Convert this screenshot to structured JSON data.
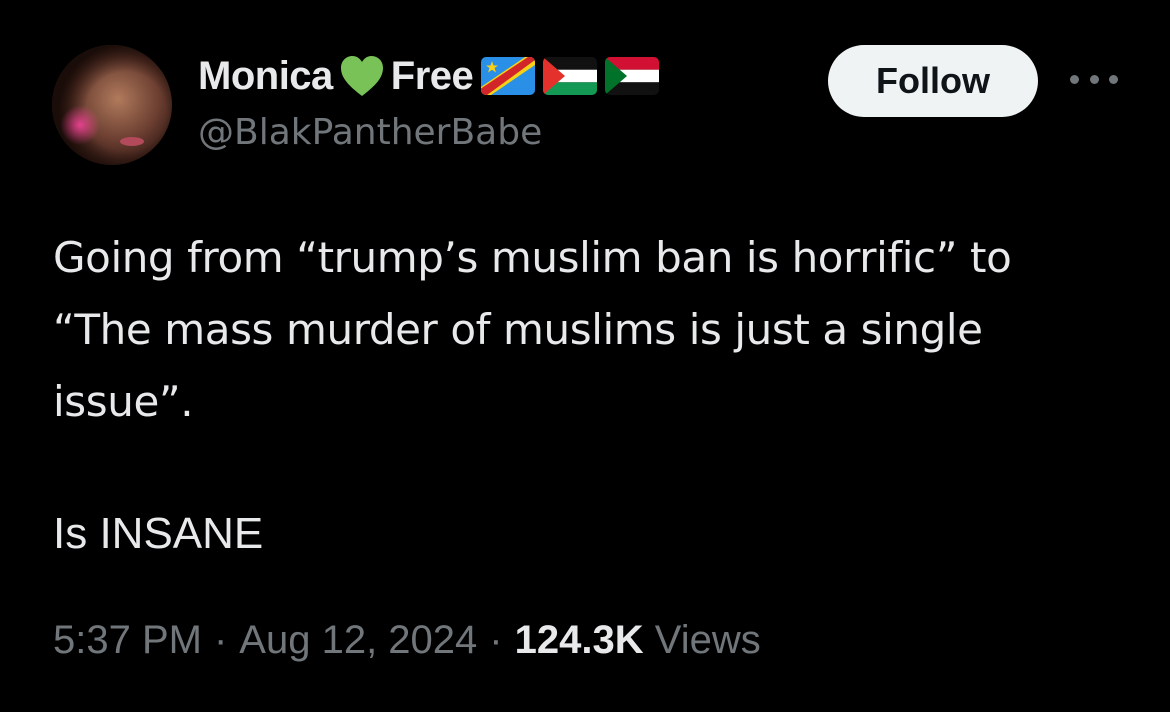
{
  "author": {
    "display_name_first": "Monica",
    "display_name_second": "Free",
    "handle": "@BlakPantherBabe",
    "heart_icon": "green-heart-icon",
    "flags": [
      "dr-congo-flag-icon",
      "palestine-flag-icon",
      "sudan-flag-icon"
    ]
  },
  "actions": {
    "follow_label": "Follow",
    "more_icon": "more-options-icon"
  },
  "tweet": {
    "lines": [
      "Going from “trump’s muslim ban is horrific” to",
      "“The mass murder of muslims is just a single",
      "issue”."
    ],
    "last_line": "Is INSANE"
  },
  "meta": {
    "time": "5:37 PM",
    "separator": "·",
    "date": "Aug 12, 2024",
    "views_count": "124.3K",
    "views_label": "Views"
  },
  "colors": {
    "background": "#000000",
    "text_primary": "#e7e9ea",
    "text_secondary": "#71767b",
    "follow_bg": "#eff3f4",
    "heart": "#78c257"
  }
}
